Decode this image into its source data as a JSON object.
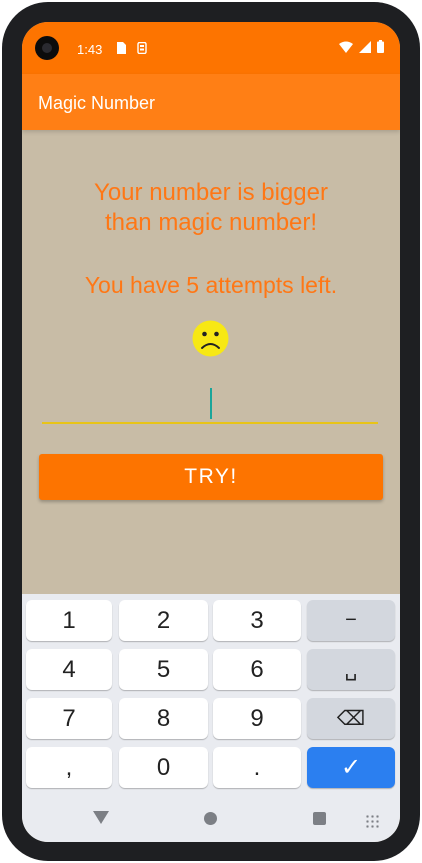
{
  "status_bar": {
    "time": "1:43",
    "icons": [
      "sim-card-icon",
      "storage-icon",
      "wifi-icon",
      "signal-icon",
      "battery-icon"
    ]
  },
  "app_bar": {
    "title": "Magic Number"
  },
  "main": {
    "message_line1": "Your number is bigger",
    "message_line2": "than magic number!",
    "attempts_text": "You have 5 attempts left.",
    "emoji_icon": "sad-face-icon",
    "number_input": {
      "value": "",
      "placeholder": ""
    },
    "try_label": "TRY!"
  },
  "keyboard": {
    "rows": [
      [
        "1",
        "2",
        "3",
        "−"
      ],
      [
        "4",
        "5",
        "6",
        "␣"
      ],
      [
        "7",
        "8",
        "9",
        "⌫"
      ],
      [
        ",",
        "0",
        ".",
        "✓"
      ]
    ]
  },
  "navigation": {
    "icons": [
      "back-icon",
      "home-icon",
      "recents-icon",
      "keyboard-switch-icon"
    ]
  },
  "colors": {
    "status_bar": "#fd7400",
    "app_bar": "#ff7f15",
    "background": "#c8bca6",
    "accent_text": "#ff7715",
    "input_underline": "#e8c418",
    "done_key": "#2b7ff0"
  }
}
